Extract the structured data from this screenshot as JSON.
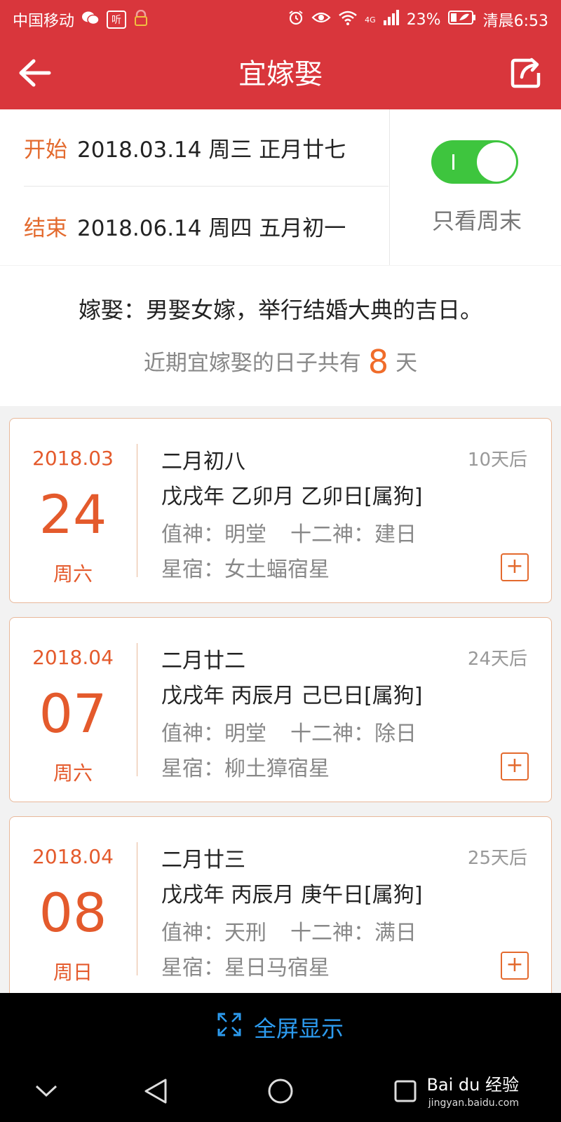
{
  "status": {
    "carrier": "中国移动",
    "app_tag": "听",
    "network": "4G",
    "battery": "23%",
    "time": "清晨6:53"
  },
  "header": {
    "title": "宜嫁娶"
  },
  "range": {
    "start_label": "开始",
    "start_value": "2018.03.14 周三 正月廿七",
    "end_label": "结束",
    "end_value": "2018.06.14 周四 五月初一",
    "weekend_only_label": "只看周末",
    "weekend_only": true
  },
  "intro": {
    "description": "嫁娶：男娶女嫁，举行结婚大典的吉日。",
    "count_prefix": "近期宜嫁娶的日子共有",
    "count": "8",
    "count_suffix": "天"
  },
  "days": [
    {
      "year_month": "2018.03",
      "day": "24",
      "weekday": "周六",
      "lunar": "二月初八",
      "in_days": "10天后",
      "ganzhi": "戊戌年 乙卯月 乙卯日[属狗]",
      "zhishen": "值神：明堂",
      "shier": "十二神：建日",
      "xingsu": "星宿：女土蝠宿星"
    },
    {
      "year_month": "2018.04",
      "day": "07",
      "weekday": "周六",
      "lunar": "二月廿二",
      "in_days": "24天后",
      "ganzhi": "戊戌年 丙辰月 己巳日[属狗]",
      "zhishen": "值神：明堂",
      "shier": "十二神：除日",
      "xingsu": "星宿：柳土獐宿星"
    },
    {
      "year_month": "2018.04",
      "day": "08",
      "weekday": "周日",
      "lunar": "二月廿三",
      "in_days": "25天后",
      "ganzhi": "戊戌年 丙辰月 庚午日[属狗]",
      "zhishen": "值神：天刑",
      "shier": "十二神：满日",
      "xingsu": "星宿：星日马宿星"
    }
  ],
  "fullscreen": {
    "label": "全屏显示"
  },
  "watermark": {
    "brand": "Bai du 经验",
    "url": "jingyan.baidu.com"
  }
}
